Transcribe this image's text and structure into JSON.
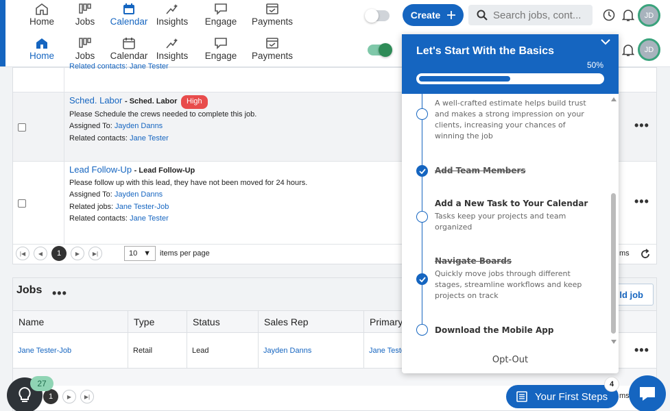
{
  "nav": {
    "items": [
      {
        "label": "Home"
      },
      {
        "label": "Jobs"
      },
      {
        "label": "Calendar"
      },
      {
        "label": "Insights"
      },
      {
        "label": "Engage"
      },
      {
        "label": "Payments"
      }
    ],
    "active_top": "Calendar",
    "active_second": "Home"
  },
  "header": {
    "create_label": "Create",
    "search_placeholder": "Search jobs, cont...",
    "avatar_initials": "JD"
  },
  "tasks": {
    "clipped_text": "Related contacts: Jane Tester",
    "rows": [
      {
        "title_link": "Sched. Labor",
        "title_tag": "- Sched. Labor",
        "priority": "High",
        "description": "Please Schedule the crews needed to complete this job.",
        "assigned_label": "Assigned To:",
        "assigned": "Jayden Danns",
        "contacts_label": "Related contacts:",
        "contacts": "Jane Tester"
      },
      {
        "title_link": "Lead Follow-Up",
        "title_tag": "- Lead Follow-Up",
        "description": "Please follow up with this lead, they have not been moved for 24 hours.",
        "assigned_label": "Assigned To:",
        "assigned": "Jayden Danns",
        "jobs_label": "Related jobs:",
        "jobs": "Jane Tester-Job",
        "contacts_label": "Related contacts:",
        "contacts": "Jane Tester"
      }
    ],
    "pager": {
      "current_page": "1",
      "per_page": "10",
      "per_page_label": "items per page",
      "items_clipped": "ms"
    }
  },
  "jobs": {
    "title": "Jobs",
    "add_job_label": "ld job",
    "columns": [
      "Name",
      "Type",
      "Status",
      "Sales Rep",
      "Primary"
    ],
    "rows": [
      {
        "name": "Jane Tester-Job",
        "type": "Retail",
        "status": "Lead",
        "sales_rep": "Jayden Danns",
        "primary": "Jane Teste"
      }
    ],
    "pager": {
      "current_page": "1",
      "items_clipped": "ms"
    }
  },
  "onboarding": {
    "title": "Let's Start With the Basics",
    "progress": 0.5,
    "progress_label": "50%",
    "steps": [
      {
        "title": "",
        "description": "A well-crafted estimate helps build trust and makes a strong impression on your clients, increasing your chances of winning the job",
        "done": false
      },
      {
        "title": "Add Team Members",
        "description": "",
        "done": true
      },
      {
        "title": "Add a New Task to Your Calendar",
        "description": "Tasks keep your projects and team organized",
        "done": false
      },
      {
        "title": "Navigate Boards",
        "description": "Quickly move jobs through different stages, streamline workflows and keep projects on track",
        "done": true
      },
      {
        "title": "Download the Mobile App",
        "description": "",
        "done": false
      }
    ],
    "opt_out_label": "Opt-Out"
  },
  "widgets": {
    "tips_count": "27",
    "first_steps_label": "Your First Steps",
    "first_steps_count": "4"
  },
  "colors": {
    "primary": "#1565c0",
    "high": "#e84c4c",
    "toggle_on": "#2e8b57"
  },
  "icons": [
    "home-icon",
    "jobs-icon",
    "calendar-icon",
    "insights-icon",
    "engage-icon",
    "payments-icon",
    "plus-icon",
    "search-icon",
    "history-icon",
    "bell-icon",
    "chevron-down-icon",
    "check-icon",
    "lightbulb-icon",
    "checklist-icon",
    "chat-icon",
    "refresh-icon"
  ]
}
